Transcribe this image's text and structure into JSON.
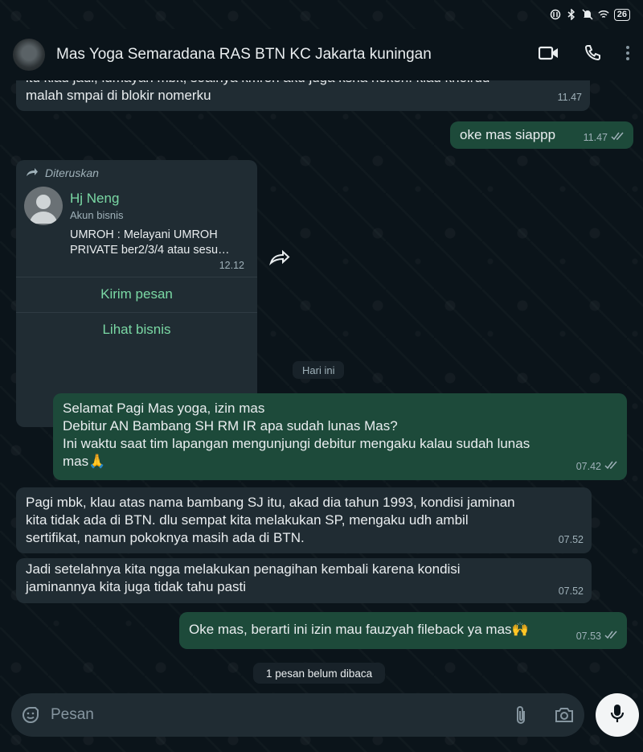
{
  "status_bar": {
    "icons": [
      "nfc-icon",
      "bluetooth-icon",
      "mute-icon",
      "wifi-icon"
    ],
    "battery": "26"
  },
  "header": {
    "contact_name": "Mas Yoga Semaradana RAS BTN KC Jakarta kuningan",
    "actions": [
      "video-call-icon",
      "phone-icon",
      "more-vert-icon"
    ]
  },
  "messages_before": [
    {
      "direction": "in",
      "text": "itu klau jadi, lumayan mbk, soalnya kmren aku juga ksna neken. klau khoirud\nmalah smpai di blokir nomerku",
      "time": "11.47"
    },
    {
      "direction": "out",
      "text": "oke mas siappp",
      "time": "11.47",
      "status": "read"
    }
  ],
  "forwarded_card": {
    "forward_label": "Diteruskan",
    "business_name": "Hj Neng",
    "business_subtitle": "Akun bisnis",
    "description": "UMROH : Melayani UMROH PRIVATE ber2/3/4 atau sesu…",
    "time": "12.12",
    "buttons": [
      "Kirim pesan",
      "Lihat bisnis"
    ]
  },
  "day_separator": "Hari ini",
  "messages_today": [
    {
      "direction": "out",
      "text": "Selamat Pagi Mas yoga, izin mas\nDebitur AN Bambang SH RM IR apa sudah lunas Mas?\nIni waktu saat tim lapangan mengunjungi debitur mengaku kalau sudah lunas\nmas🙏",
      "time": "07.42",
      "status": "read"
    },
    {
      "direction": "in",
      "text": "Pagi mbk, klau atas nama bambang SJ itu, akad dia tahun 1993, kondisi jaminan\nkita tidak ada di BTN. dlu sempat kita melakukan SP, mengaku udh ambil\nsertifikat, namun pokoknya masih ada di BTN.",
      "time": "07.52"
    },
    {
      "direction": "in",
      "text": "Jadi setelahnya kita ngga melakukan penagihan kembali karena kondisi\njaminannya kita juga tidak tahu pasti",
      "time": "07.52"
    },
    {
      "direction": "out",
      "text": "Oke mas, berarti ini izin mau fauzyah fileback ya mas🙌",
      "time": "07.53",
      "status": "read"
    }
  ],
  "unread_banner": "1 pesan belum dibaca",
  "composer": {
    "placeholder": "Pesan",
    "icons": [
      "sticker-icon",
      "attach-icon",
      "camera-icon",
      "mic-icon"
    ]
  },
  "colors": {
    "background": "#0b141a",
    "incoming_bubble": "#202c33",
    "outgoing_bubble": "#1d4a3a",
    "accent_green": "#7ad8a4"
  }
}
